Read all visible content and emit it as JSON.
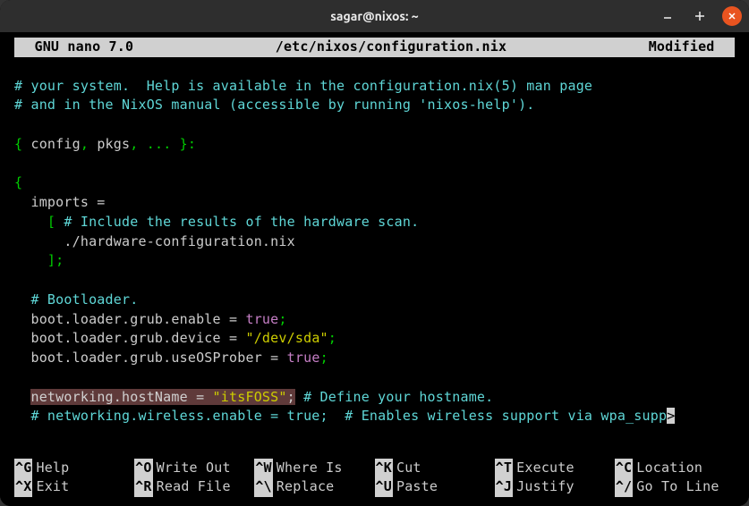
{
  "window": {
    "title": "sagar@nixos: ~"
  },
  "editor": {
    "app": "  GNU nano 7.0",
    "file": "/etc/nixos/configuration.nix",
    "status": "Modified  "
  },
  "code": {
    "l1_a": "# your system.  Help is available in the configuration.nix(5) man page",
    "l2_a": "# and in the NixOS manual (accessible by running 'nixos-help').",
    "l4_a": "{ ",
    "l4_b": "config",
    "l4_c": ", ",
    "l4_d": "pkgs",
    "l4_e": ", ... }:",
    "l6_a": "{",
    "l7_a": "  imports =",
    "l8_a": "    [ ",
    "l8_b": "# Include the results of the hardware scan.",
    "l9_a": "      ./hardware-configuration.nix",
    "l10_a": "    ];",
    "l12_a": "  # Bootloader.",
    "l13_a": "  boot.loader.grub.enable = ",
    "l13_b": "true",
    "l13_c": ";",
    "l14_a": "  boot.loader.grub.device = ",
    "l14_b": "\"/dev/sda\"",
    "l14_c": ";",
    "l15_a": "  boot.loader.grub.useOSProber = ",
    "l15_b": "true",
    "l15_c": ";",
    "l17_a": "  ",
    "l17_b": "networking.hostName = ",
    "l17_c": "\"itsFOSS\"",
    "l17_d": ";",
    "l17_e": " # Define your hostname.",
    "l18_a": "  # networking.wireless.enable = true;  # Enables wireless support via wpa_supp",
    "l18_b": ">"
  },
  "shortcuts": [
    {
      "key": "^G",
      "label": "Help"
    },
    {
      "key": "^O",
      "label": "Write Out"
    },
    {
      "key": "^W",
      "label": "Where Is"
    },
    {
      "key": "^K",
      "label": "Cut"
    },
    {
      "key": "^T",
      "label": "Execute"
    },
    {
      "key": "^C",
      "label": "Location"
    },
    {
      "key": "^X",
      "label": "Exit"
    },
    {
      "key": "^R",
      "label": "Read File"
    },
    {
      "key": "^\\",
      "label": "Replace"
    },
    {
      "key": "^U",
      "label": "Paste"
    },
    {
      "key": "^J",
      "label": "Justify"
    },
    {
      "key": "^/",
      "label": "Go To Line"
    }
  ]
}
